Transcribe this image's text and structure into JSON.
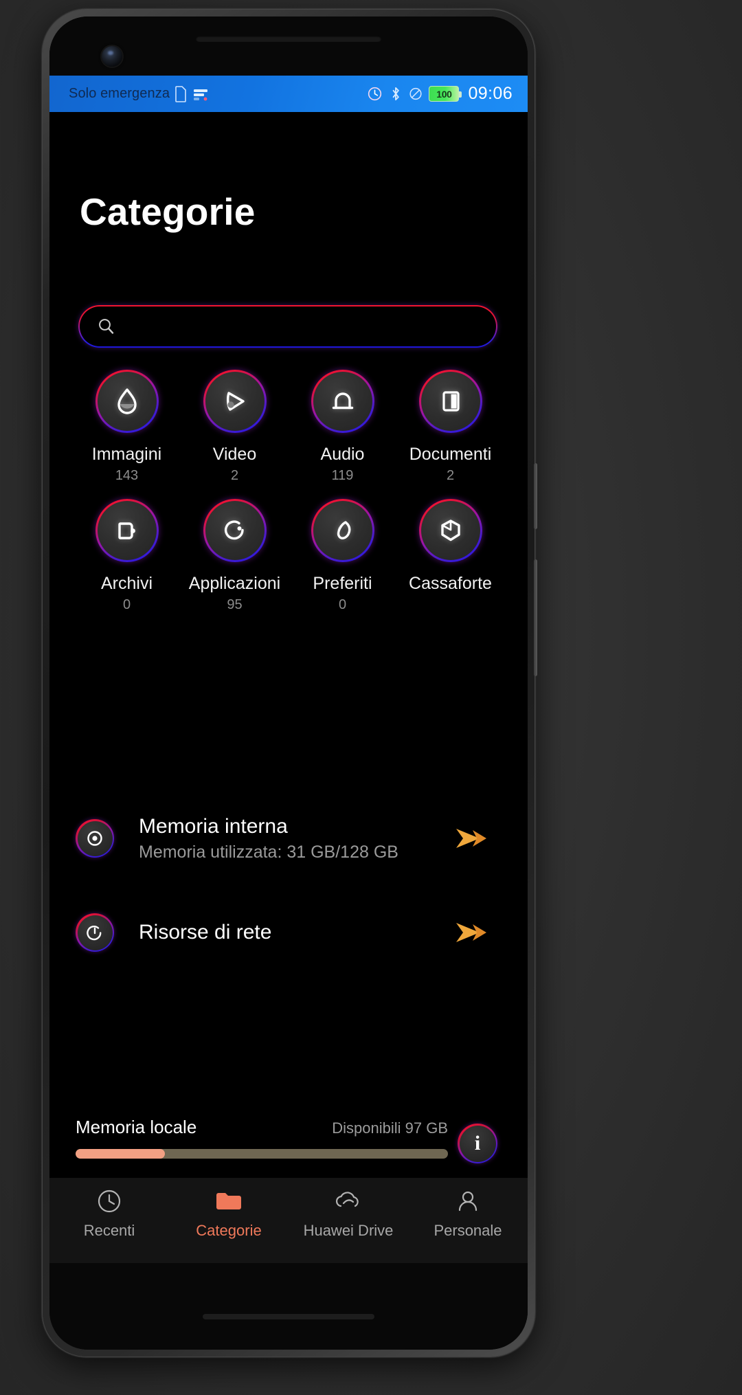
{
  "device": {
    "camera": "front-camera",
    "speaker": "earpiece-speaker"
  },
  "statusbar": {
    "carrier": "Solo emergenza",
    "sim_icon": "sim-card-icon",
    "signal_icon": "signal-bars-icon",
    "alarm_icon": "alarm-clock-icon",
    "bluetooth_icon": "bluetooth-icon",
    "mute_icon": "mute-icon",
    "battery_level": "100",
    "battery_icon": "battery-full-icon",
    "time": "09:06"
  },
  "page": {
    "title": "Categorie"
  },
  "search": {
    "placeholder": "",
    "value": "",
    "icon": "search-icon"
  },
  "categories": [
    {
      "label": "Immagini",
      "count": "143",
      "icon": "image-drop-icon"
    },
    {
      "label": "Video",
      "count": "2",
      "icon": "video-play-icon"
    },
    {
      "label": "Audio",
      "count": "119",
      "icon": "bell-audio-icon"
    },
    {
      "label": "Documenti",
      "count": "2",
      "icon": "document-icon"
    },
    {
      "label": "Archivi",
      "count": "0",
      "icon": "archive-zip-icon"
    },
    {
      "label": "Applicazioni",
      "count": "95",
      "icon": "apps-circle-icon"
    },
    {
      "label": "Preferiti",
      "count": "0",
      "icon": "favorite-heart-icon"
    },
    {
      "label": "Cassaforte",
      "count": "",
      "icon": "safe-box-icon"
    }
  ],
  "storage_rows": [
    {
      "title": "Memoria interna",
      "subtitle": "Memoria utilizzata: 31 GB/128 GB",
      "icon": "internal-storage-icon",
      "arrow_icon": "chevron-right-icon"
    },
    {
      "title": "Risorse di rete",
      "subtitle": "",
      "icon": "network-share-icon",
      "arrow_icon": "chevron-right-icon"
    }
  ],
  "local_memory": {
    "title": "Memoria locale",
    "available": "Disponibili 97 GB",
    "used_percent": 24,
    "info_icon": "info-icon",
    "info_glyph": "i",
    "fill_color": "#f2a083",
    "track_color": "#6f6752"
  },
  "bottom_nav": [
    {
      "label": "Recenti",
      "icon": "clock-icon",
      "active": false
    },
    {
      "label": "Categorie",
      "icon": "folder-icon",
      "active": true
    },
    {
      "label": "Huawei Drive",
      "icon": "cloud-icon",
      "active": false
    },
    {
      "label": "Personale",
      "icon": "person-icon",
      "active": false
    }
  ],
  "colors": {
    "accent": "#f0795a",
    "statusbar": "#1273e0",
    "ring_start": "#ff1030",
    "ring_end": "#2018e8"
  }
}
